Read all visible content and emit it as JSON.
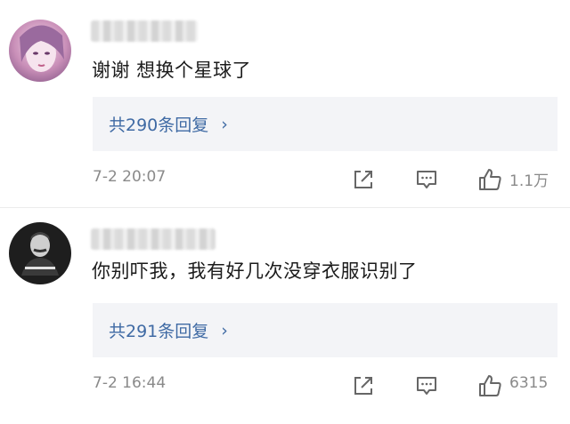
{
  "comments": [
    {
      "text": "谢谢 想换个星球了",
      "replies_label": "共290条回复",
      "replies_arrow": "›",
      "time": "7-2 20:07",
      "likes": "1.1万"
    },
    {
      "text": "你别吓我，我有好几次没穿衣服识别了",
      "replies_label": "共291条回复",
      "replies_arrow": "›",
      "time": "7-2 16:44",
      "likes": "6315"
    }
  ],
  "colors": {
    "link": "#3f6aa4",
    "meta": "#8a8a8a",
    "reply_bg": "#f3f4f7"
  },
  "icons": [
    "share-icon",
    "comment-icon",
    "like-icon"
  ]
}
